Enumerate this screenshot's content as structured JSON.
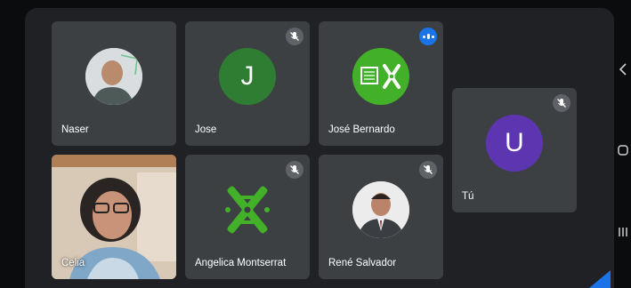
{
  "participants": [
    {
      "name": "Naser",
      "mic": "none"
    },
    {
      "name": "Jose",
      "initial": "J",
      "avatar_color": "#2e7d32",
      "mic": "muted"
    },
    {
      "name": "José Bernardo",
      "mic": "speaking"
    },
    {
      "name": "Tú",
      "initial": "U",
      "avatar_color": "#5e35b1",
      "mic": "muted"
    },
    {
      "name": "Celia",
      "mic": "none"
    },
    {
      "name": "Angelica Montserrat",
      "mic": "muted"
    },
    {
      "name": "René Salvador",
      "mic": "muted"
    }
  ],
  "icons": {
    "muted": "mic-off-icon",
    "speaking": "audio-level-icon",
    "nav_back": "back-icon",
    "nav_home": "home-icon",
    "nav_recents": "recents-icon"
  },
  "colors": {
    "background": "#202124",
    "tile": "#3c4043",
    "accent": "#1a73e8",
    "logo_green": "#43b02a"
  }
}
